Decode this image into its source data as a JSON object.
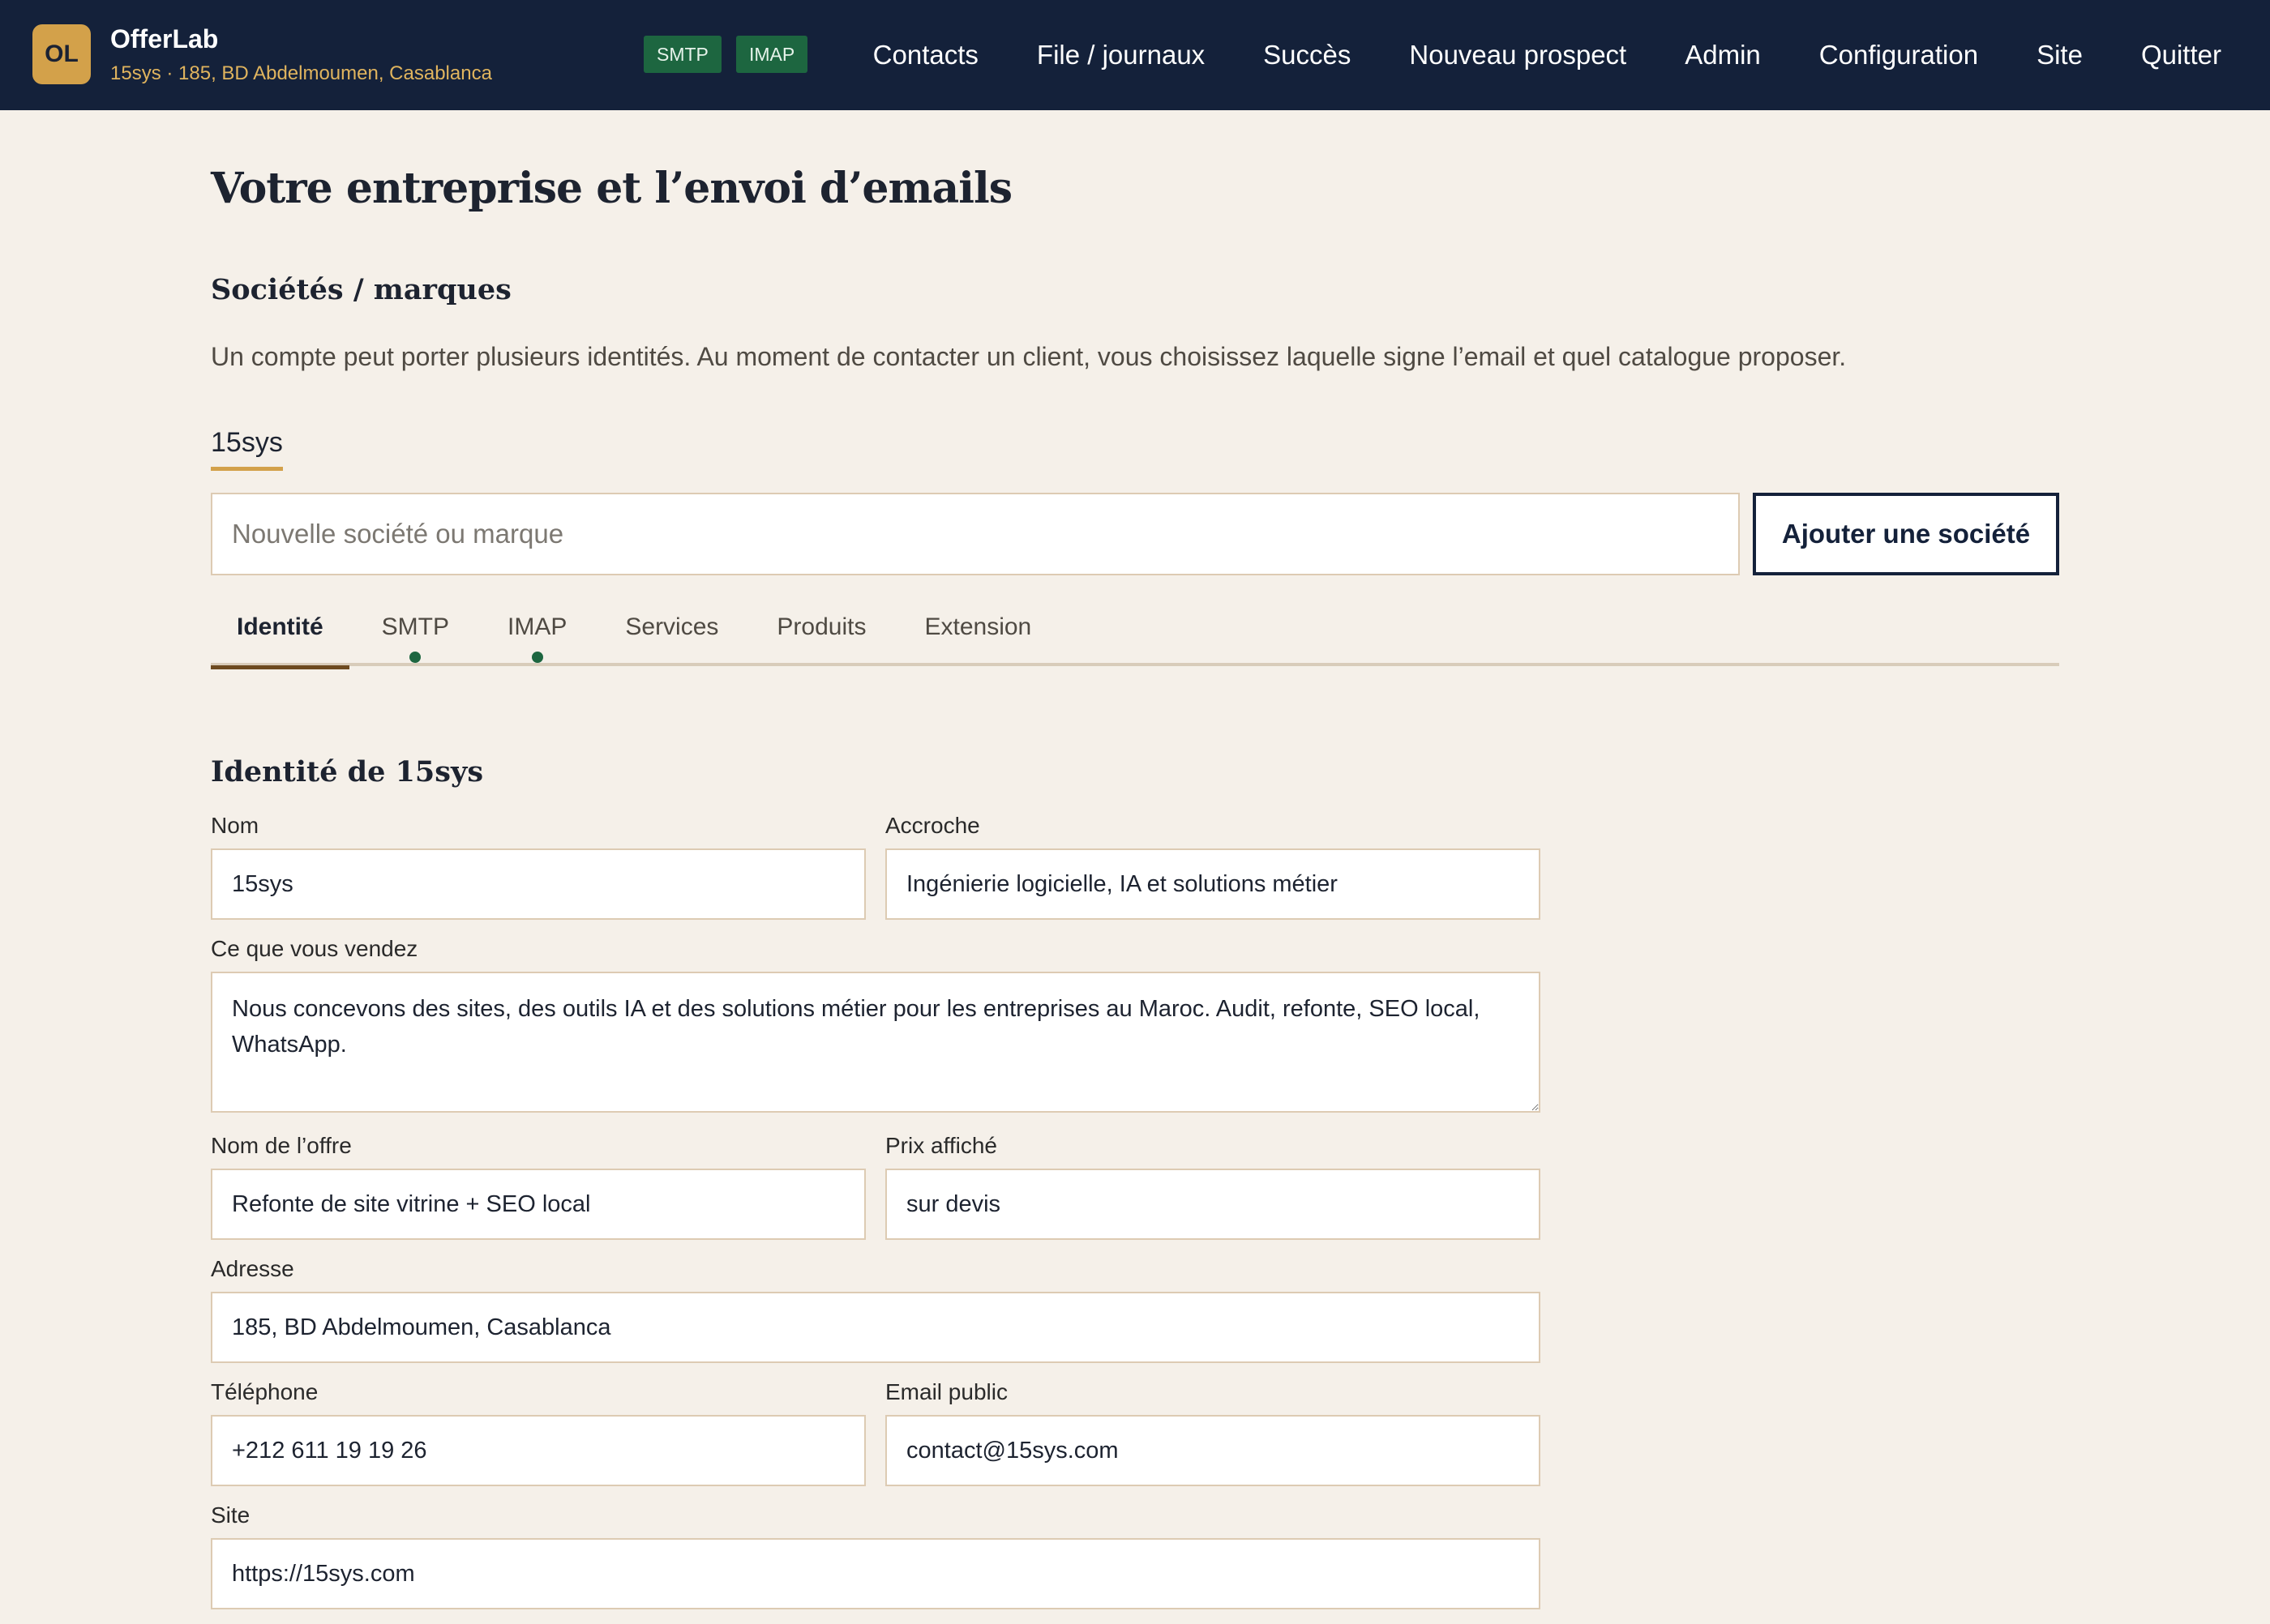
{
  "header": {
    "logo_initials": "OL",
    "app_name": "OfferLab",
    "subtitle": "15sys · 185, BD Abdelmoumen, Casablanca",
    "badges": [
      "SMTP",
      "IMAP"
    ],
    "nav": [
      "Contacts",
      "File / journaux",
      "Succès",
      "Nouveau prospect",
      "Admin",
      "Configuration",
      "Site",
      "Quitter"
    ]
  },
  "page": {
    "title": "Votre entreprise et l’envoi d’emails",
    "section_title": "Sociétés / marques",
    "section_desc": "Un compte peut porter plusieurs identités. Au moment de contacter un client, vous choisissez laquelle signe l’email et quel catalogue proposer.",
    "company_tab": "15sys",
    "new_company_placeholder": "Nouvelle société ou marque",
    "add_button": "Ajouter une société"
  },
  "tabs": [
    {
      "label": "Identité",
      "active": true,
      "dot": false
    },
    {
      "label": "SMTP",
      "active": false,
      "dot": true
    },
    {
      "label": "IMAP",
      "active": false,
      "dot": true
    },
    {
      "label": "Services",
      "active": false,
      "dot": false
    },
    {
      "label": "Produits",
      "active": false,
      "dot": false
    },
    {
      "label": "Extension",
      "active": false,
      "dot": false
    }
  ],
  "form": {
    "title": "Identité de 15sys",
    "nom_label": "Nom",
    "nom_value": "15sys",
    "accroche_label": "Accroche",
    "accroche_value": "Ingénierie logicielle, IA et solutions métier",
    "vendez_label": "Ce que vous vendez",
    "vendez_value": "Nous concevons des sites, des outils IA et des solutions métier pour les entreprises au Maroc. Audit, refonte, SEO local, WhatsApp.",
    "offre_label": "Nom de l’offre",
    "offre_value": "Refonte de site vitrine + SEO local",
    "prix_label": "Prix affiché",
    "prix_value": "sur devis",
    "adresse_label": "Adresse",
    "adresse_value": "185, BD Abdelmoumen, Casablanca",
    "telephone_label": "Téléphone",
    "telephone_value": "+212 611 19 19 26",
    "email_label": "Email public",
    "email_value": "contact@15sys.com",
    "site_label": "Site",
    "site_value": "https://15sys.com"
  },
  "colors": {
    "topbar": "#14213a",
    "accent_gold": "#d3a14a",
    "status_green": "#1d6640",
    "page_bg": "#f5f0e9"
  }
}
